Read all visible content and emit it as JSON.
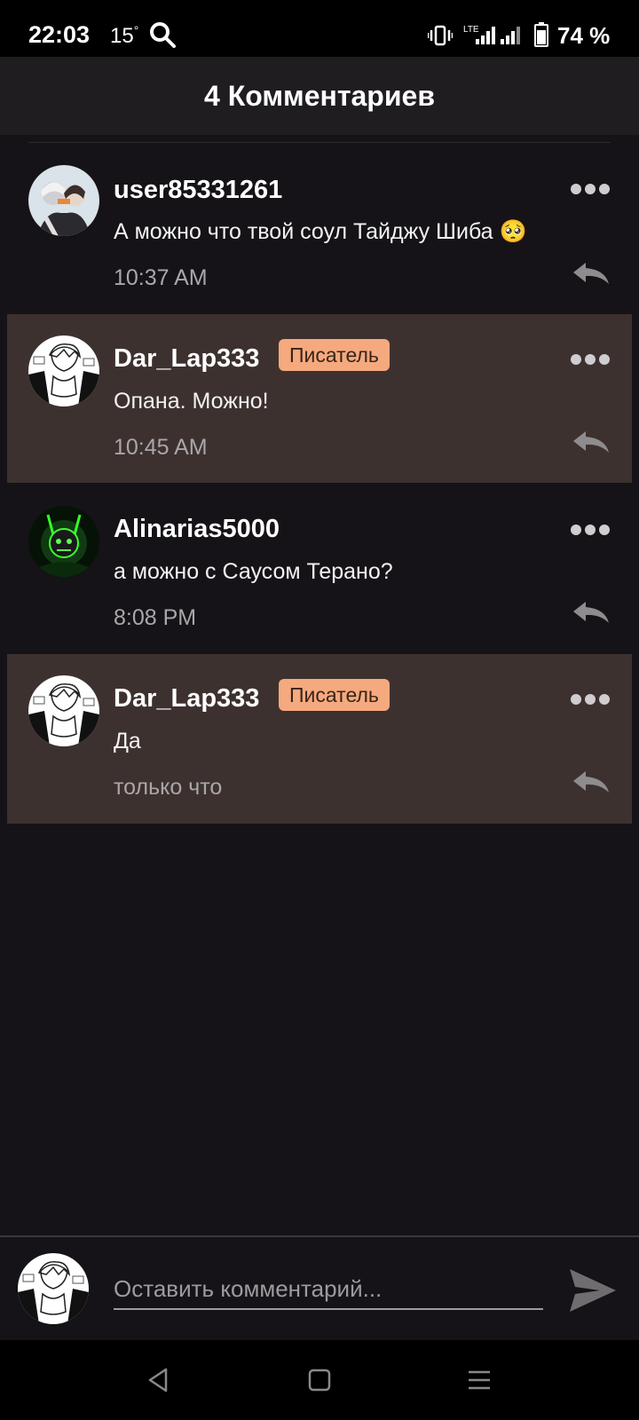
{
  "status_bar": {
    "time": "22:03",
    "temperature": "15",
    "degree": "°",
    "network": "LTE",
    "battery": "74 %"
  },
  "header": {
    "title": "4 Комментариев"
  },
  "comments": [
    {
      "username": "user85331261",
      "badge": "",
      "text": "А можно что твой соул Тайджу Шиба 🥺",
      "time": "10:37 AM",
      "is_author": false,
      "avatar": "anime-pair-avatar"
    },
    {
      "username": "Dar_Lap333",
      "badge": "Писатель",
      "text": "Опана. Можно!",
      "time": "10:45 AM",
      "is_author": true,
      "avatar": "manga-avatar"
    },
    {
      "username": "Alinarias5000",
      "badge": "",
      "text": "а можно с Саусом Терано?",
      "time": "8:08 PM",
      "is_author": false,
      "avatar": "green-neon-avatar"
    },
    {
      "username": "Dar_Lap333",
      "badge": "Писатель",
      "text": "Да",
      "time": "только что",
      "is_author": true,
      "avatar": "manga-avatar"
    }
  ],
  "composer": {
    "placeholder": "Оставить комментарий..."
  },
  "colors": {
    "background": "#151317",
    "header": "#1f1d20",
    "author_highlight": "#3d312f",
    "badge": "#f5a97e",
    "muted": "#a9a7aa"
  }
}
